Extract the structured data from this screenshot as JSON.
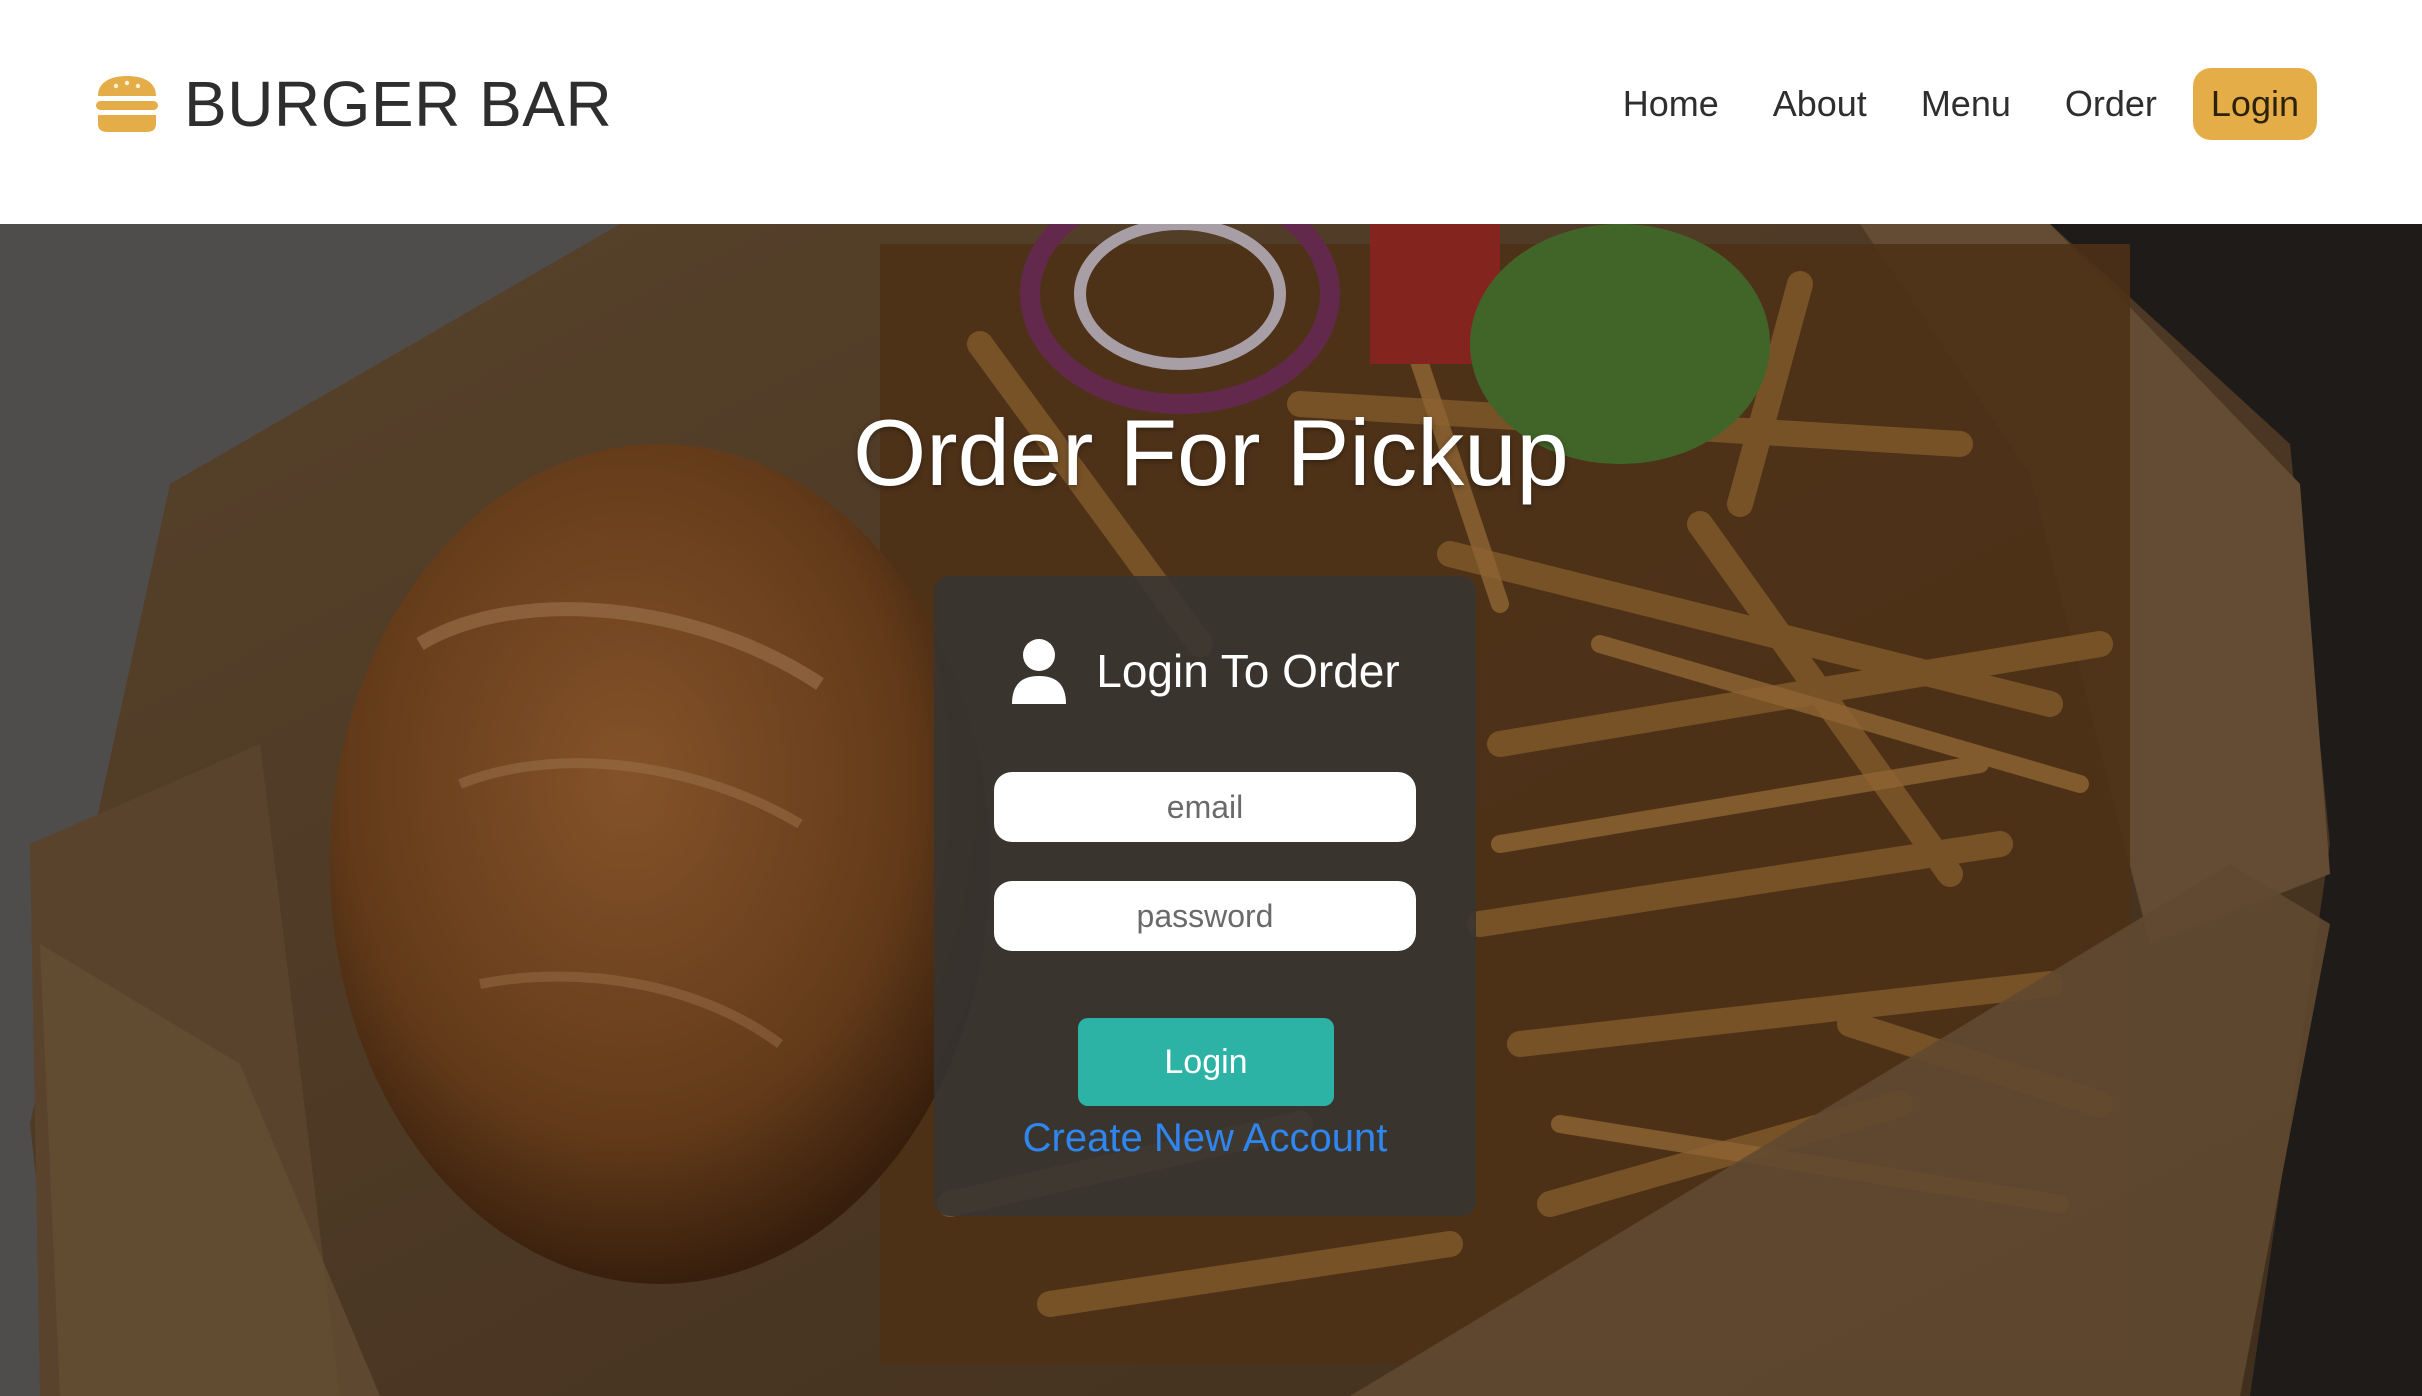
{
  "brand": {
    "name": "BURGER BAR",
    "icon": "burger-icon",
    "icon_color": "#e5ad47"
  },
  "nav": {
    "items": [
      {
        "label": "Home",
        "active": false
      },
      {
        "label": "About",
        "active": false
      },
      {
        "label": "Menu",
        "active": false
      },
      {
        "label": "Order",
        "active": false
      },
      {
        "label": "Login",
        "active": true
      }
    ],
    "active_color": "#e5ad47"
  },
  "hero": {
    "title": "Order For Pickup",
    "background": "burger-and-fries-image"
  },
  "login_card": {
    "title": "Login To Order",
    "icon": "user-icon",
    "email": {
      "placeholder": "email",
      "value": ""
    },
    "password": {
      "placeholder": "password",
      "value": ""
    },
    "submit_label": "Login",
    "submit_color": "#2db3a6",
    "create_account_label": "Create New Account",
    "link_color": "#2f86ef"
  }
}
